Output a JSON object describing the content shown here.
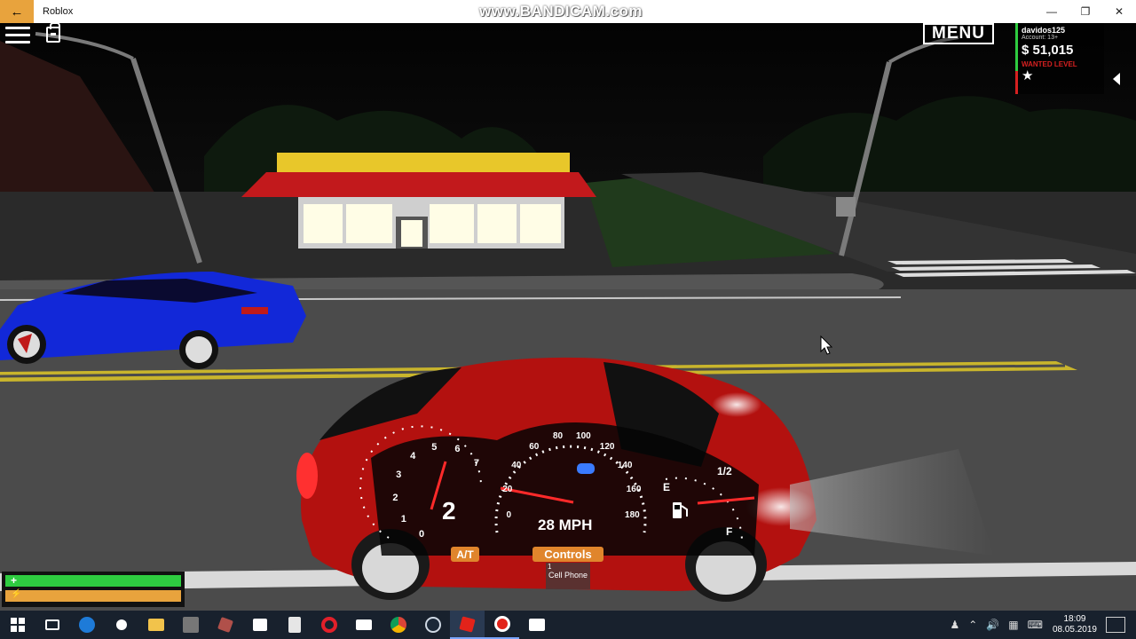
{
  "window": {
    "app_title": "Roblox",
    "watermark": "www.BANDICAM.com",
    "back_icon": "back-arrow-icon",
    "minimize_label": "—",
    "maximize_label": "❐",
    "close_label": "✕"
  },
  "hud": {
    "menu_label": "MENU",
    "player": {
      "username": "davidos125",
      "account": "Account: 13+",
      "money": "$ 51,015",
      "wanted_label": "WANTED LEVEL",
      "wanted_star": "★",
      "wanted_stars": 1
    },
    "health_icon": "+",
    "stamina_icon": "⚡",
    "health_level": 1.0,
    "stamina_level": 1.0,
    "health_color": "#2ecc40",
    "stamina_color": "#e8a33d"
  },
  "dashboard": {
    "gear": "2",
    "speed": "28 MPH",
    "rpm_ticks": [
      "0",
      "1",
      "2",
      "3",
      "4",
      "5",
      "6",
      "7"
    ],
    "speed_ticks": [
      "0",
      "20",
      "40",
      "60",
      "80",
      "100",
      "120",
      "140",
      "160",
      "180"
    ],
    "fuel_labels": {
      "empty": "E",
      "half": "1/2",
      "full": "F"
    },
    "at_label": "A/T",
    "controls_label": "Controls",
    "cell_phone_num": "1",
    "cell_phone_label": "Cell Phone",
    "accent_color": "#e0852c"
  },
  "taskbar": {
    "time": "18:09",
    "date": "08.05.2019"
  }
}
